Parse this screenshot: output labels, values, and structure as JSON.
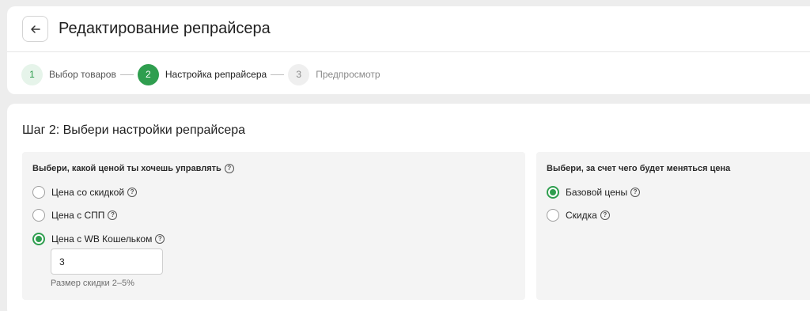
{
  "header": {
    "title": "Редактирование репрайсера",
    "back_icon": "arrow-left-icon"
  },
  "steps": [
    {
      "number": "1",
      "label": "Выбор товаров",
      "state": "done"
    },
    {
      "number": "2",
      "label": "Настройка репрайсера",
      "state": "active"
    },
    {
      "number": "3",
      "label": "Предпросмотр",
      "state": "todo"
    }
  ],
  "section": {
    "title": "Шаг 2: Выбери настройки репрайсера"
  },
  "price_control": {
    "heading": "Выбери, какой ценой ты хочешь управлять",
    "options": [
      {
        "label": "Цена со скидкой",
        "checked": false
      },
      {
        "label": "Цена с СПП",
        "checked": false
      },
      {
        "label": "Цена с WB Кошельком",
        "checked": true
      }
    ],
    "input_value": "3",
    "hint": "Размер скидки 2–5%"
  },
  "change_source": {
    "heading": "Выбери, за счет чего будет меняться цена",
    "options": [
      {
        "label": "Базовой цены",
        "checked": true
      },
      {
        "label": "Скидка",
        "checked": false
      }
    ]
  },
  "colors": {
    "accent": "#2f9e4f",
    "background": "#ededed",
    "panel": "#f4f4f4"
  }
}
